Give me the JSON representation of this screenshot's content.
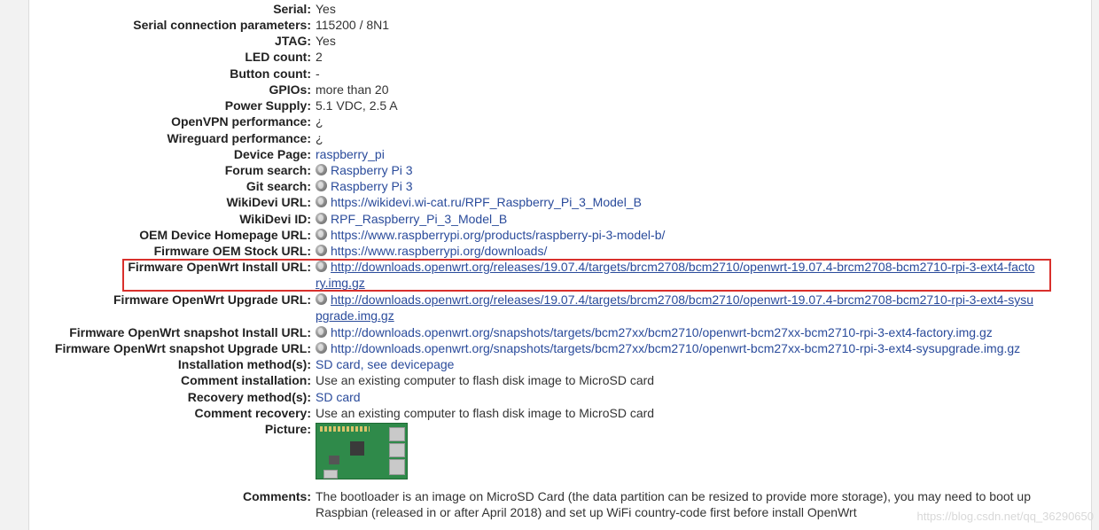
{
  "rows": {
    "serial": {
      "label": "Serial:",
      "value": "Yes"
    },
    "serial_params": {
      "label": "Serial connection parameters:",
      "value": "115200 / 8N1"
    },
    "jtag": {
      "label": "JTAG:",
      "value": "Yes"
    },
    "led_count": {
      "label": "LED count:",
      "value": "2"
    },
    "button_count": {
      "label": "Button count:",
      "value": "-"
    },
    "gpios": {
      "label": "GPIOs:",
      "value": "more than 20"
    },
    "power_supply": {
      "label": "Power Supply:",
      "value": "5.1 VDC, 2.5 A"
    },
    "openvpn": {
      "label": "OpenVPN performance:",
      "value": "¿"
    },
    "wireguard": {
      "label": "Wireguard performance:",
      "value": "¿"
    },
    "device_page": {
      "label": "Device Page:",
      "value": "raspberry_pi"
    },
    "forum_search": {
      "label": "Forum search:",
      "value": "Raspberry Pi 3"
    },
    "git_search": {
      "label": "Git search:",
      "value": "Raspberry Pi 3"
    },
    "wikidevi_url": {
      "label": "WikiDevi URL:",
      "value": "https://wikidevi.wi-cat.ru/RPF_Raspberry_Pi_3_Model_B"
    },
    "wikidevi_id": {
      "label": "WikiDevi ID:",
      "value": "RPF_Raspberry_Pi_3_Model_B"
    },
    "oem_homepage": {
      "label": "OEM Device Homepage URL:",
      "value": "https://www.raspberrypi.org/products/raspberry-pi-3-model-b/"
    },
    "firmware_oem": {
      "label": "Firmware OEM Stock URL:",
      "value": "https://www.raspberrypi.org/downloads/"
    },
    "fw_install": {
      "label": "Firmware OpenWrt Install URL:",
      "value": "http://downloads.openwrt.org/releases/19.07.4/targets/brcm2708/bcm2710/openwrt-19.07.4-brcm2708-bcm2710-rpi-3-ext4-factory.img.gz"
    },
    "fw_upgrade": {
      "label": "Firmware OpenWrt Upgrade URL:",
      "value": "http://downloads.openwrt.org/releases/19.07.4/targets/brcm2708/bcm2710/openwrt-19.07.4-brcm2708-bcm2710-rpi-3-ext4-sysupgrade.img.gz"
    },
    "snap_install": {
      "label": "Firmware OpenWrt snapshot Install URL:",
      "value": "http://downloads.openwrt.org/snapshots/targets/bcm27xx/bcm2710/openwrt-bcm27xx-bcm2710-rpi-3-ext4-factory.img.gz"
    },
    "snap_upgrade": {
      "label": "Firmware OpenWrt snapshot Upgrade URL:",
      "value": "http://downloads.openwrt.org/snapshots/targets/bcm27xx/bcm2710/openwrt-bcm27xx-bcm2710-rpi-3-ext4-sysupgrade.img.gz"
    },
    "install_method": {
      "label": "Installation method(s):",
      "value": "SD card, see devicepage"
    },
    "comment_install": {
      "label": "Comment installation:",
      "value": "Use an existing computer to flash disk image to MicroSD card"
    },
    "recovery_method": {
      "label": "Recovery method(s):",
      "value": "SD card"
    },
    "comment_recovery": {
      "label": "Comment recovery:",
      "value": "Use an existing computer to flash disk image to MicroSD card"
    },
    "picture": {
      "label": "Picture:"
    },
    "comments": {
      "label": "Comments:",
      "value": "The bootloader is an image on MicroSD Card (the data partition can be resized to provide more storage), you may need to boot up Raspbian (released in or after April 2018) and set up WiFi country-code first before install OpenWrt"
    }
  },
  "watermark": "https://blog.csdn.net/qq_36290650",
  "colors": {
    "link": "#2a4b9b",
    "highlight": "#d9302c"
  }
}
